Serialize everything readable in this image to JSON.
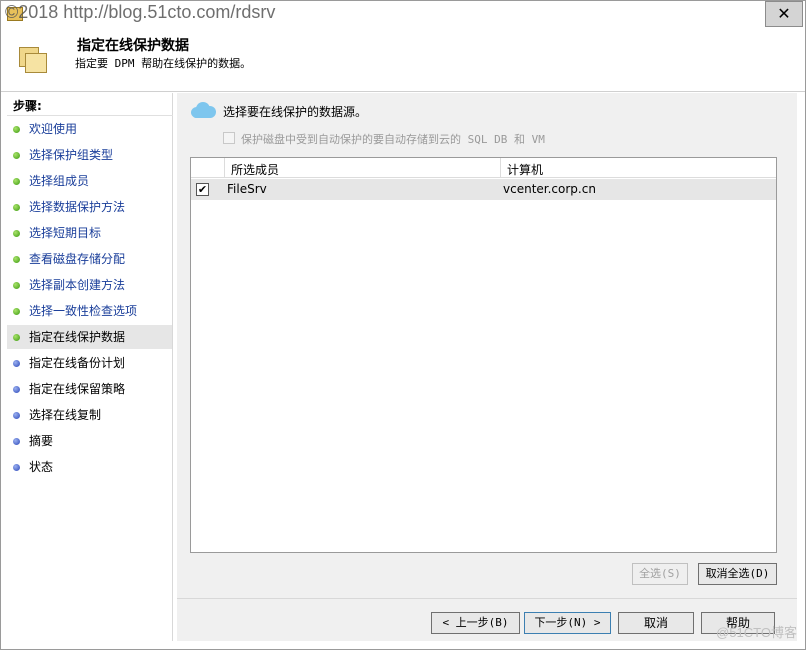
{
  "window": {
    "title_watermark": "©2018 http://blog.51cto.com/rdsrv",
    "close_label": "✕"
  },
  "header": {
    "title": "指定在线保护数据",
    "subtitle": "指定要 DPM 帮助在线保护的数据。"
  },
  "sidebar": {
    "steps_label": "步骤:",
    "items": [
      {
        "label": "欢迎使用",
        "state": "done"
      },
      {
        "label": "选择保护组类型",
        "state": "done"
      },
      {
        "label": "选择组成员",
        "state": "done"
      },
      {
        "label": "选择数据保护方法",
        "state": "done"
      },
      {
        "label": "选择短期目标",
        "state": "done"
      },
      {
        "label": "查看磁盘存储分配",
        "state": "done"
      },
      {
        "label": "选择副本创建方法",
        "state": "done"
      },
      {
        "label": "选择一致性检查选项",
        "state": "done"
      },
      {
        "label": "指定在线保护数据",
        "state": "active"
      },
      {
        "label": "指定在线备份计划",
        "state": "todo"
      },
      {
        "label": "指定在线保留策略",
        "state": "todo"
      },
      {
        "label": "选择在线复制",
        "state": "todo"
      },
      {
        "label": "摘要",
        "state": "todo"
      },
      {
        "label": "状态",
        "state": "todo"
      }
    ]
  },
  "main": {
    "instruction": "选择要在线保护的数据源。",
    "auto_protect_label": "保护磁盘中受到自动保护的要自动存储到云的 SQL DB 和 VM",
    "table": {
      "columns": [
        "所选成员",
        "计算机"
      ],
      "rows": [
        {
          "checked": true,
          "member": "FileSrv",
          "computer": "vcenter.corp.cn"
        }
      ]
    },
    "select_all_label": "全选(S)",
    "clear_all_label": "取消全选(D)"
  },
  "footer": {
    "prev_label": "< 上一步(B)",
    "next_label": "下一步(N) >",
    "cancel_label": "取消",
    "help_label": "帮助"
  },
  "watermark_bottom": "@51CTO博客",
  "colors": {
    "done_link": "#1a3e9a",
    "active_bg": "#e6e6e6",
    "main_bg": "#f0f0f0"
  }
}
